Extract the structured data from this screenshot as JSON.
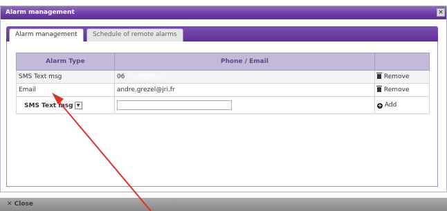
{
  "dialog": {
    "title": "Alarm management",
    "close_symbol": "×"
  },
  "tabs": [
    {
      "label": "Alarm management",
      "active": true
    },
    {
      "label": "Schedule of remote alarms",
      "active": false
    }
  ],
  "table": {
    "headers": [
      "Alarm Type",
      "Phone / Email",
      ""
    ],
    "rows": [
      {
        "type": "SMS Text msg",
        "contact": "06",
        "action": "Remove"
      },
      {
        "type": "Email",
        "contact": "andre.grezel@jri.fr",
        "action": "Remove"
      }
    ],
    "add_row": {
      "selected_type": "SMS Text msg",
      "dropdown_symbol": "▼",
      "input_value": "",
      "add_label": "Add",
      "add_symbol": "+"
    }
  },
  "footer": {
    "close_label": "✕ Close"
  },
  "icons": [
    "trash-icon",
    "plus-circle-icon",
    "close-icon",
    "dropdown-arrow-icon"
  ],
  "colors": {
    "titlebar": "#6e3fa8",
    "header_bg": "#c3bad8",
    "annotation_arrow": "#e0302a"
  }
}
